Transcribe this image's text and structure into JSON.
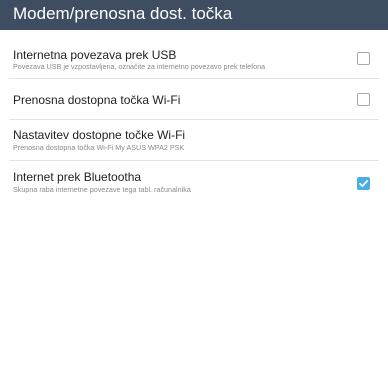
{
  "action_bar": {
    "title": "Modem/prenosna dost. točka"
  },
  "preferences": [
    {
      "title": "Internetna povezava prek USB",
      "summary": "Povezava USB je vzpostavljena, označite za internetno povezavo prek telefona",
      "checked": false
    },
    {
      "title": "Prenosna dostopna točka Wi-Fi",
      "summary": "",
      "checked": false
    },
    {
      "title": "Nastavitev dostopne točke Wi-Fi",
      "summary": "Prenosna dostopna točka Wi-Fi My ASUS WPA2 PSK"
    },
    {
      "title": "Internet prek Bluetootha",
      "summary": "Skupna raba internetne povezave tega tabl. računalnika",
      "checked": true
    }
  ],
  "colors": {
    "action_bar": "#3f4d63",
    "checkbox_checked": "#49aee6"
  }
}
